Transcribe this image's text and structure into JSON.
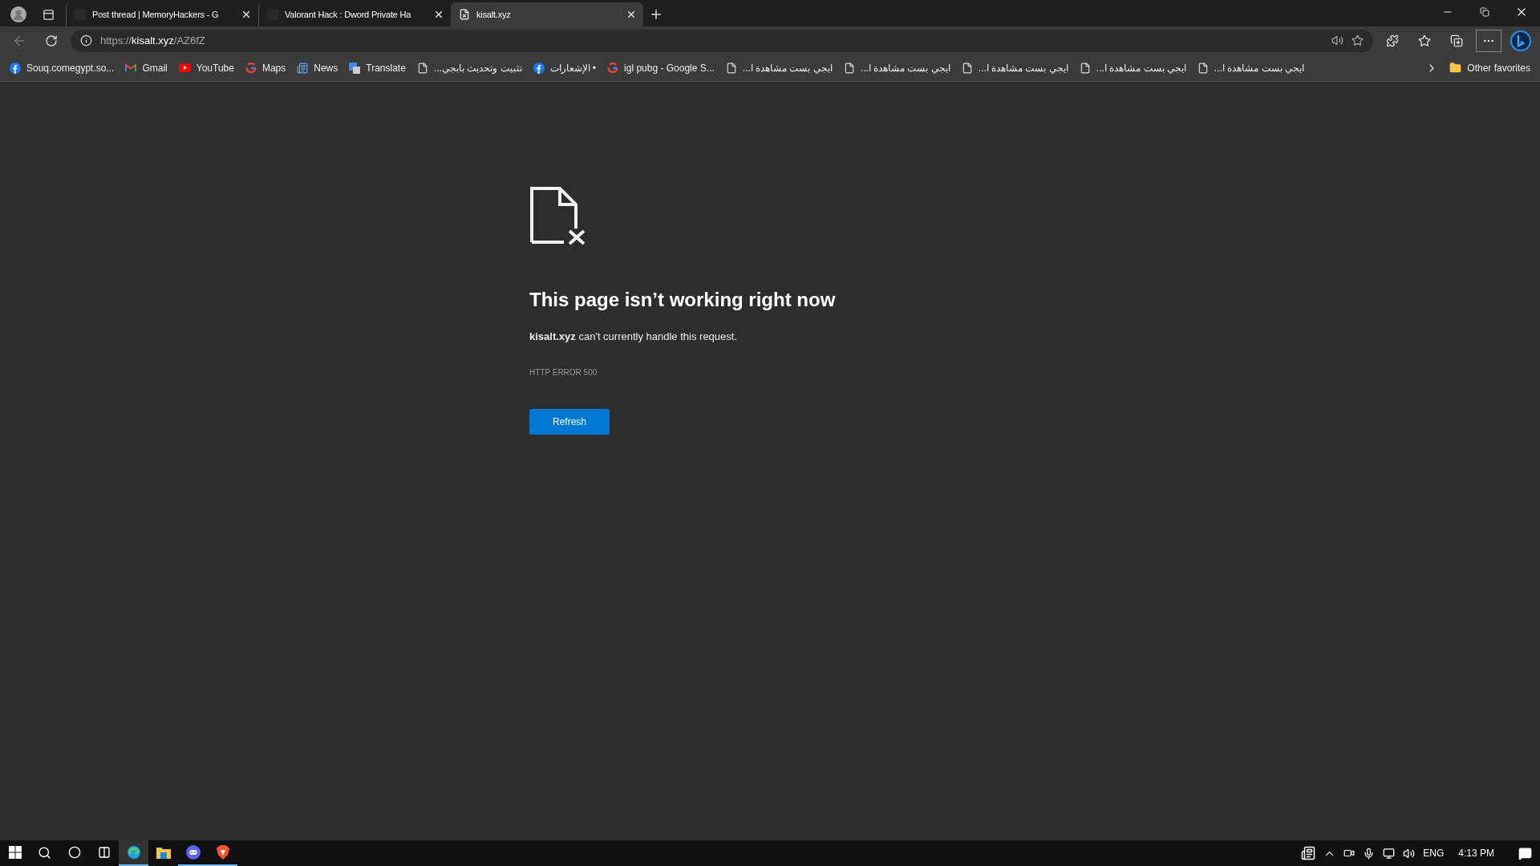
{
  "tabs": [
    {
      "title": "Post thread | MemoryHackers - G",
      "kind": "site",
      "selected": false
    },
    {
      "title": "Valorant Hack : Dword Private Ha",
      "kind": "site",
      "selected": false
    },
    {
      "title": "kisalt.xyz",
      "kind": "error",
      "selected": true
    }
  ],
  "address": {
    "scheme": "https://",
    "host": "kisalt.xyz",
    "path": "/AZ6fZ"
  },
  "bookmarks": [
    {
      "label": "Souq.comegypt.so...",
      "kind": "facebook"
    },
    {
      "label": "Gmail",
      "kind": "gmail"
    },
    {
      "label": "YouTube",
      "kind": "youtube"
    },
    {
      "label": "Maps",
      "kind": "google"
    },
    {
      "label": "News",
      "kind": "news"
    },
    {
      "label": "Translate",
      "kind": "translate"
    },
    {
      "label": "تثبيت وتحديث بابجي...",
      "kind": "page"
    },
    {
      "label": "• الإشعارات",
      "kind": "facebook"
    },
    {
      "label": "igl pubg - Google S...",
      "kind": "google"
    },
    {
      "label": "ايجي بست مشاهدة ا...",
      "kind": "page"
    },
    {
      "label": "ايجي بست مشاهدة ا...",
      "kind": "page"
    },
    {
      "label": "ايجي بست مشاهدة ا...",
      "kind": "page"
    },
    {
      "label": "ايجي بست مشاهدة ا...",
      "kind": "page"
    },
    {
      "label": "ايجي بست مشاهدة ا...",
      "kind": "page"
    }
  ],
  "other_favorites": "Other favorites",
  "error": {
    "title": "This page isn’t working right now",
    "message": "**kisalt.xyz** can't currently handle this request.",
    "code": "HTTP ERROR 500",
    "button": "Refresh"
  },
  "taskbar": {
    "apps": [
      {
        "kind": "edge",
        "open": true,
        "selected": true
      },
      {
        "kind": "explorer",
        "open": false,
        "selected": false
      },
      {
        "kind": "discord",
        "open": true,
        "selected": false
      },
      {
        "kind": "brave",
        "open": true,
        "selected": false
      }
    ],
    "language": "ENG",
    "time": "4:13 PM"
  }
}
